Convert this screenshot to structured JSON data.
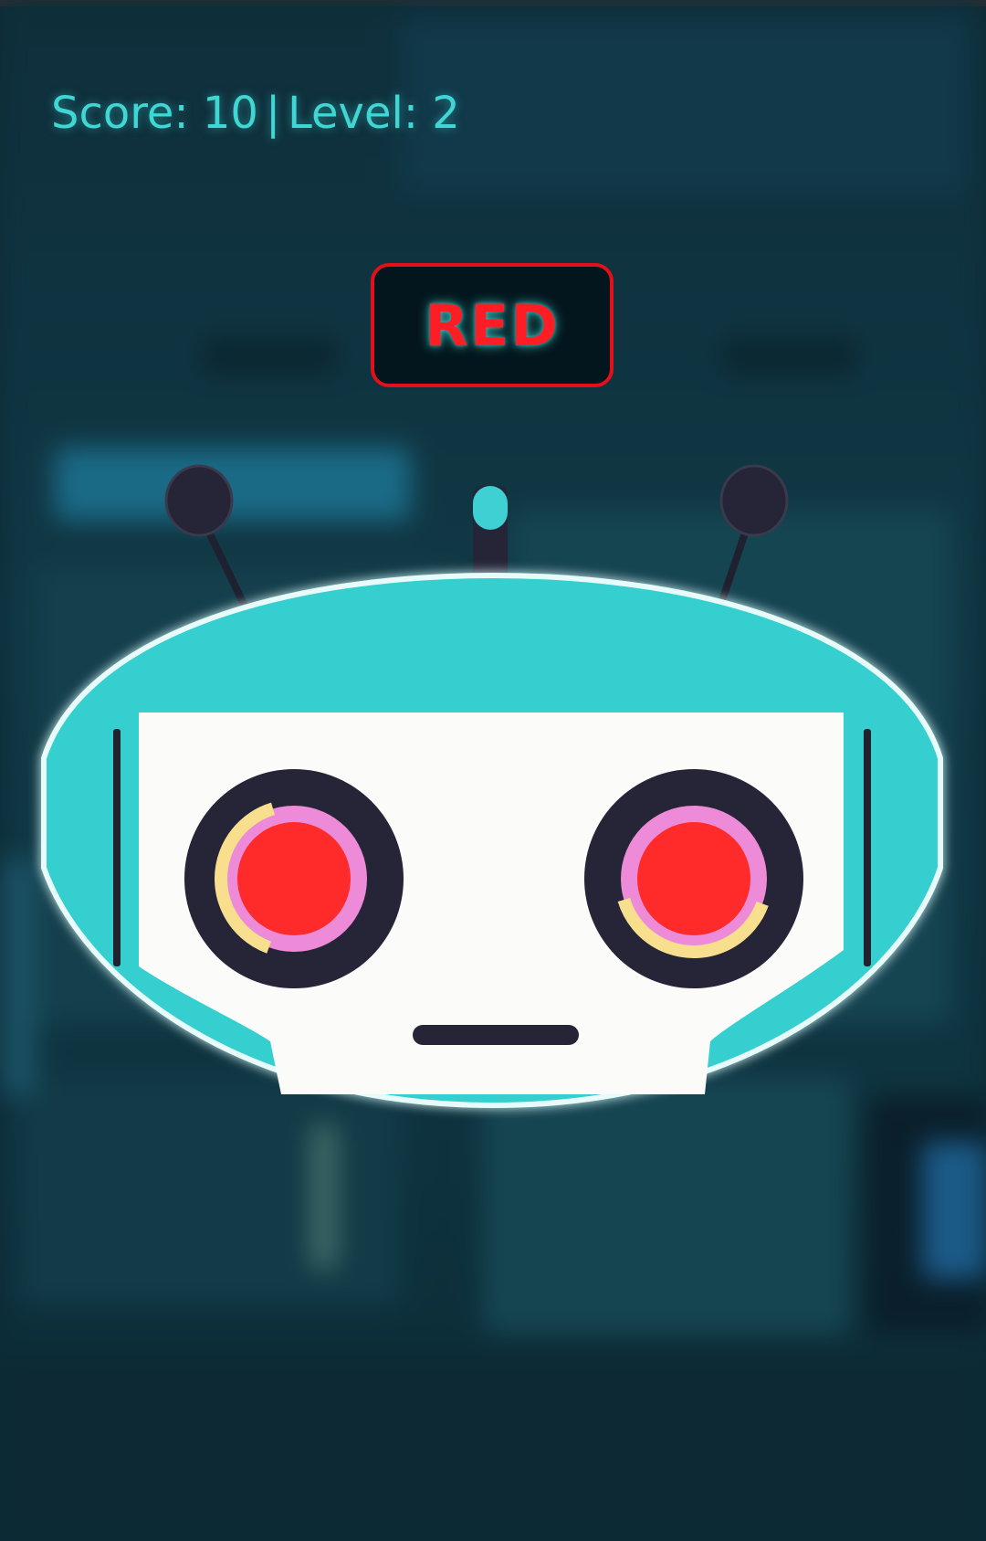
{
  "hud": {
    "score_label": "Score: 10",
    "separator": "|",
    "level_label": "Level: 2"
  },
  "prompt": {
    "word": "RED",
    "border_color": "#e3101c",
    "text_color": "#ff1d25"
  },
  "robot": {
    "eye_color": "#ff2a2a",
    "head_color": "#36cfcf",
    "face_color": "#ffffff"
  },
  "theme": {
    "accent": "#3fd6d4",
    "background": "#0d2b36"
  }
}
